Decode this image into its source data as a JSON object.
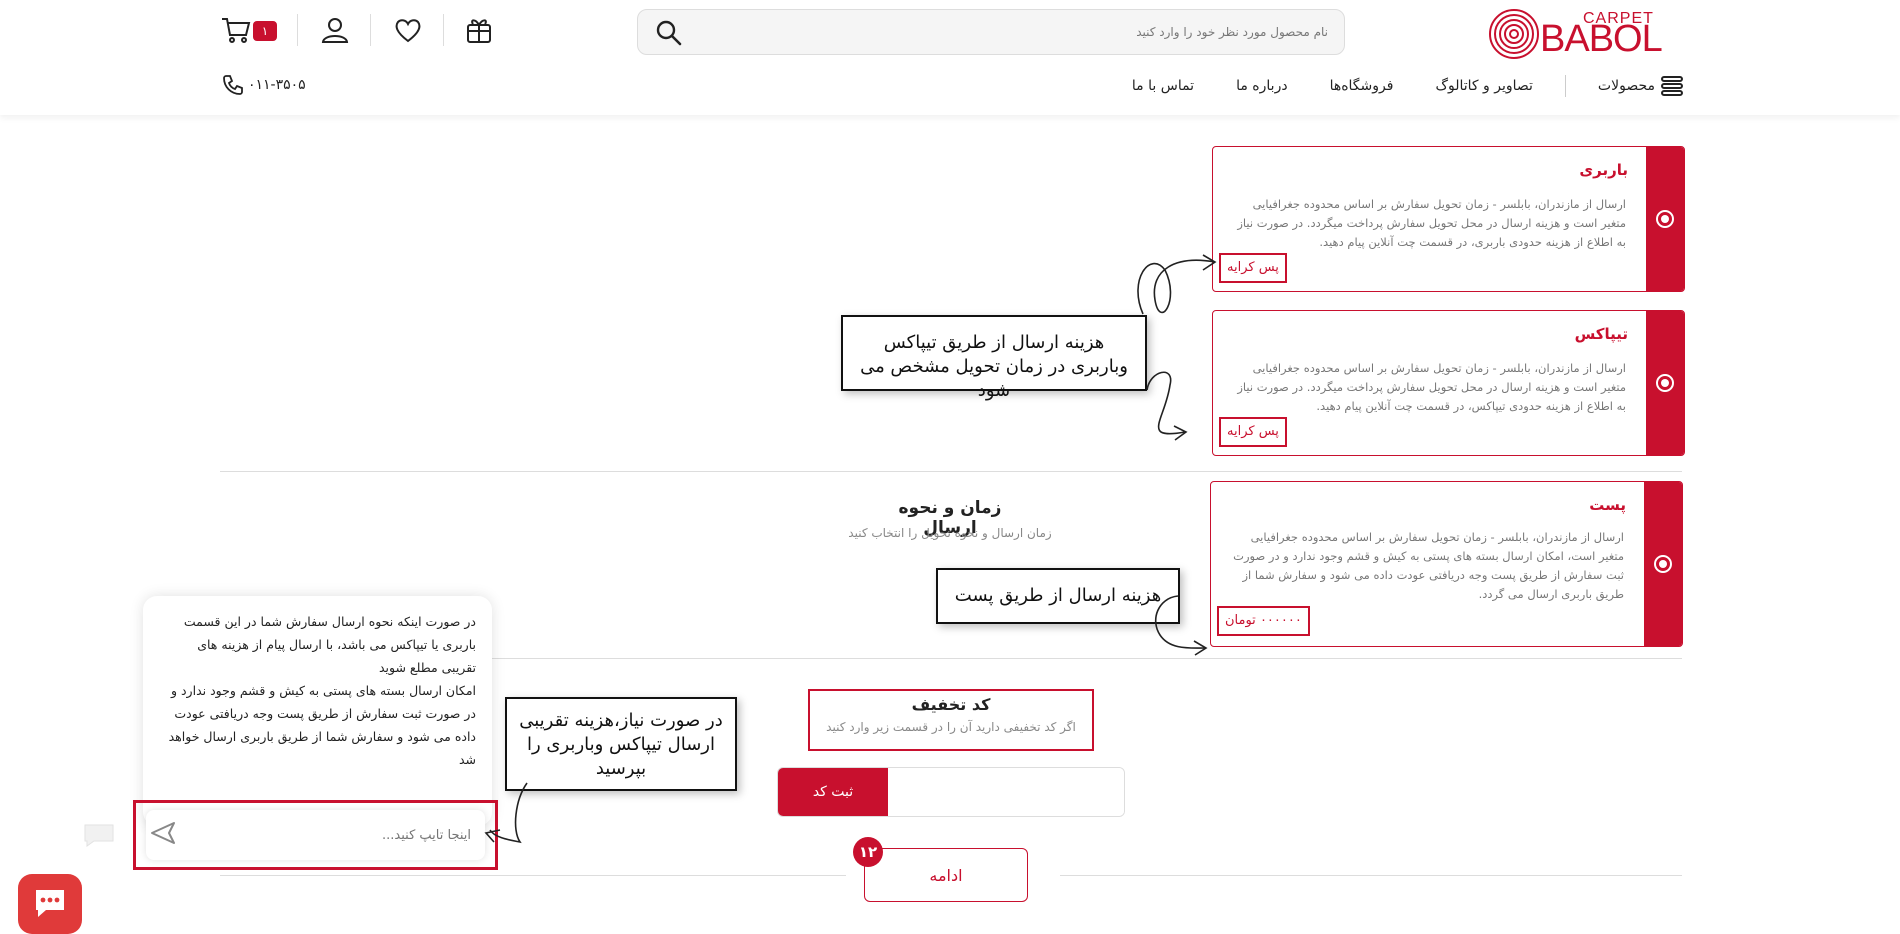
{
  "header": {
    "logo_top": "CARPET",
    "logo_main": "BABOL",
    "search_placeholder": "نام محصول مورد نظر خود را وارد کنید",
    "cart_count": "۱",
    "phone": "۰۱۱-۳۵۰۵",
    "nav": {
      "products": "محصولات",
      "gallery": "تصاویر و کاتالوگ",
      "stores": "فروشگاه‌ها",
      "about": "درباره ما",
      "contact": "تماس با ما"
    }
  },
  "shipping_section": {
    "title": "زمان و نحوه ارسال",
    "subtitle": "زمان ارسال و نحوه تحویل را انتخاب کنید"
  },
  "shipping_options": [
    {
      "title": "باربری",
      "description": "ارسال از مازندران، بابلسر - زمان تحویل سفارش بر اساس محدوده جغرافیایی متغیر است و هزینه ارسال در محل تحویل سفارش پرداخت میگردد. در صورت نیاز به اطلاع از هزینه حدودی باربری، در قسمت چت آنلاین پیام دهید.",
      "price": "پس کرایه"
    },
    {
      "title": "تیپاکس",
      "description": "ارسال از مازندران، بابلسر - زمان تحویل سفارش بر اساس محدوده جغرافیایی متغیر است و هزینه ارسال در محل تحویل سفارش پرداخت میگردد. در صورت نیاز به اطلاع از هزینه حدودی تیپاکس، در قسمت چت آنلاین پیام دهید.",
      "price": "پس کرایه"
    },
    {
      "title": "پست",
      "description": "ارسال از مازندران، بابلسر - زمان تحویل سفارش بر اساس محدوده جغرافیایی متغیر است، امکان ارسال بسته های پستی به کیش و قشم وجود ندارد و در صورت ثبت سفارش از طریق پست وجه دریافتی عودت داده می شود و سفارش شما از طریق باربری ارسال می گردد.",
      "price": "۰۰۰۰۰۰ تومان"
    }
  ],
  "annotations": {
    "tipax_barbari": "هزینه ارسال از طریق تیپاکس وباربری در زمان تحویل مشخص می شود",
    "post": "هزینه ارسال از طریق پست",
    "chat_hint": "در صورت نیاز،هزینه تقریبی ارسال تیپاکس وباربری را بپرسید"
  },
  "discount": {
    "title": "کد تخفیف",
    "subtitle": "اگر کد تخفیفی دارید آن را در قسمت زیر وارد کنید",
    "button": "ثبت کد"
  },
  "continue": {
    "label": "ادامه",
    "step": "۱۲"
  },
  "chat": {
    "message": "در صورت اینکه نحوه ارسال سفارش شما در این قسمت باربری یا تیپاکس می باشد، با ارسال پیام از هزینه های تقریبی مطلع شوید\nامکان ارسال بسته های پستی به کیش و قشم وجود ندارد و در صورت ثبت سفارش از طریق پست وجه دریافتی عودت داده می شود و سفارش شما از طریق باربری ارسال خواهد شد",
    "input_placeholder": "اینجا تایپ کنید..."
  },
  "colors": {
    "brand": "#c8102e",
    "fab": "#e03a3a"
  }
}
